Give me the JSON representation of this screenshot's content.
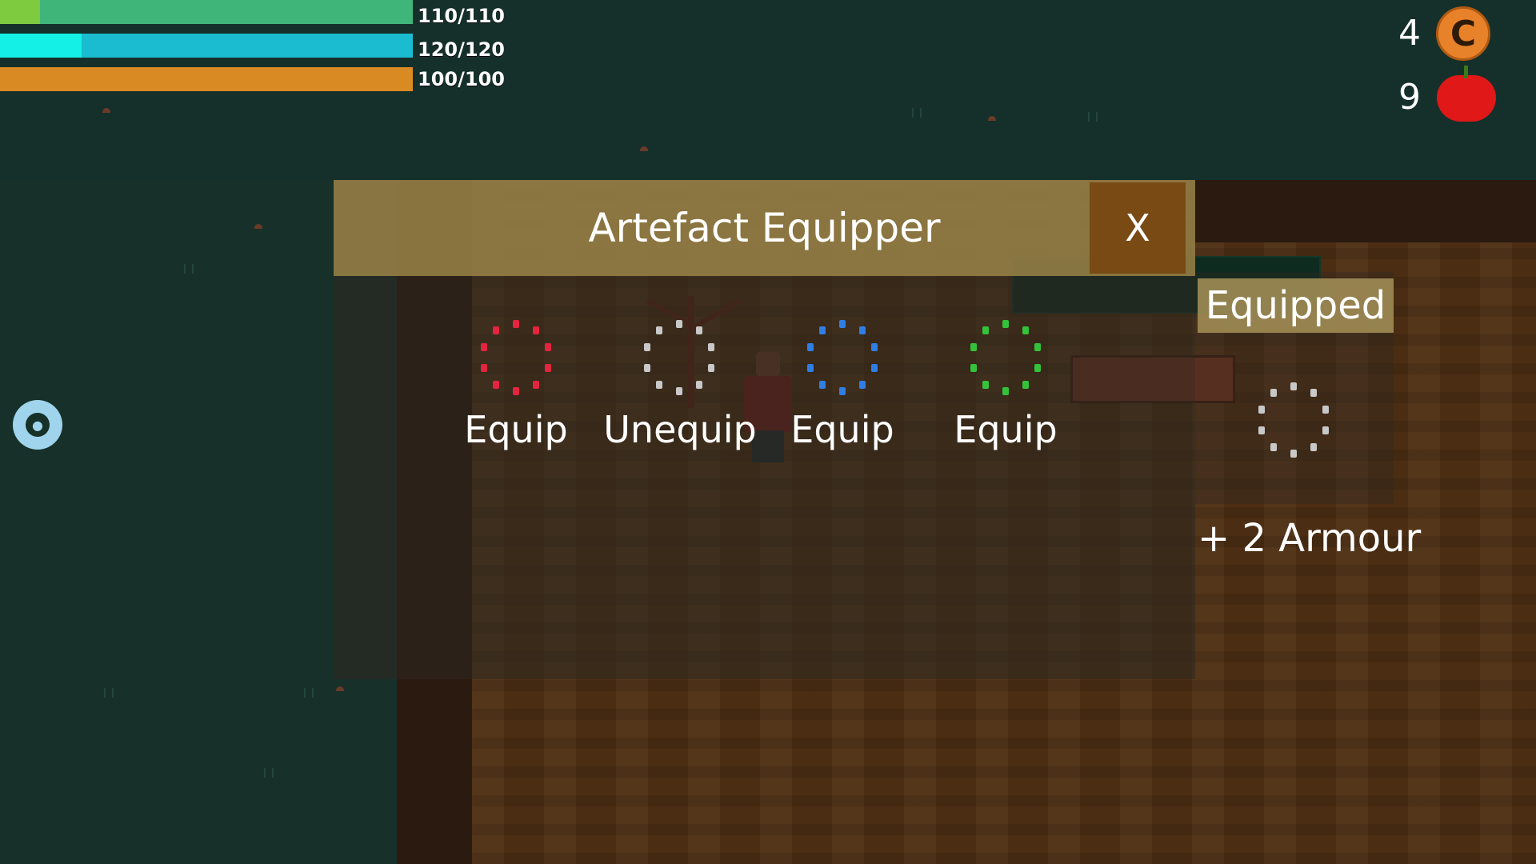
{
  "hud": {
    "health": {
      "label": "110/110",
      "fraction": 1.0,
      "color": "#3fb57a",
      "accent": "#7ecb40"
    },
    "mana": {
      "label": "120/120",
      "fraction": 1.0,
      "color": "#1bbbd0",
      "accent": "#14f0e6"
    },
    "stamina": {
      "label": "100/100",
      "fraction": 1.0,
      "color": "#d98a22"
    }
  },
  "resources": {
    "coins": {
      "count": "4",
      "icon": "coin-icon",
      "symbol": "C"
    },
    "apples": {
      "count": "9",
      "icon": "apple-icon"
    }
  },
  "settings": {
    "icon": "gear-icon"
  },
  "dialog": {
    "title": "Artefact Equipper",
    "close_label": "X",
    "slots": [
      {
        "ring_color": "#e5243f",
        "button": "Equip"
      },
      {
        "ring_color": "#c8c8c8",
        "button": "Unequip"
      },
      {
        "ring_color": "#2f7ee6",
        "button": "Equip"
      },
      {
        "ring_color": "#34c23a",
        "button": "Equip"
      }
    ],
    "equipped": {
      "label": "Equipped",
      "ring_color": "#c8c8c8",
      "stat": "+ 2 Armour"
    }
  }
}
